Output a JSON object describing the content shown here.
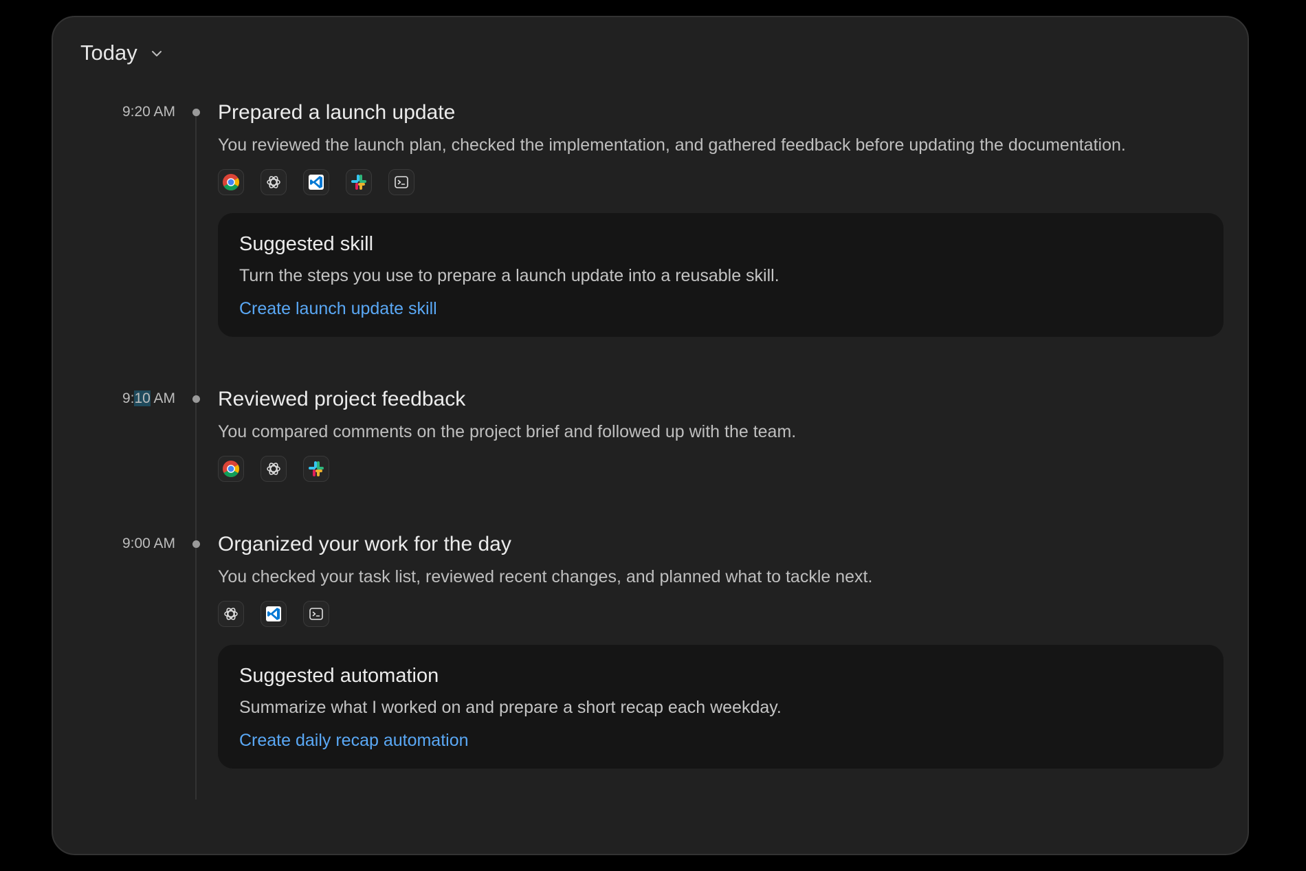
{
  "header": {
    "title": "Today",
    "chevron_icon": "chevron-down-icon"
  },
  "colors": {
    "background": "#000000",
    "panel": "#212121",
    "card": "#151515",
    "link": "#5aa8f5",
    "text_primary": "#ececec",
    "text_secondary": "#bfbfbf"
  },
  "entries": [
    {
      "time_prefix": "9:20 AM",
      "time_highlight": "",
      "time_suffix": "",
      "title": "Prepared a launch update",
      "description": "You reviewed the launch plan, checked the implementation, and gathered feedback before updating the documentation.",
      "apps": [
        "chrome-icon",
        "chatgpt-icon",
        "vscode-icon",
        "slack-icon",
        "terminal-icon"
      ],
      "suggestion": {
        "title": "Suggested skill",
        "description": "Turn the steps you use to prepare a launch update into a reusable skill.",
        "action": "Create launch update skill"
      }
    },
    {
      "time_prefix": "9:",
      "time_highlight": "10",
      "time_suffix": " AM",
      "title": "Reviewed project feedback",
      "description": "You compared comments on the project brief and followed up with the team.",
      "apps": [
        "chrome-icon",
        "chatgpt-icon",
        "slack-icon"
      ]
    },
    {
      "time_prefix": "9:00 AM",
      "time_highlight": "",
      "time_suffix": "",
      "title": "Organized your work for the day",
      "description": "You checked your task list, reviewed recent changes, and planned what to tackle next.",
      "apps": [
        "chatgpt-icon",
        "vscode-icon",
        "terminal-icon"
      ],
      "suggestion": {
        "title": "Suggested automation",
        "description": "Summarize what I worked on and prepare a short recap each weekday.",
        "action": "Create daily recap automation"
      }
    }
  ]
}
